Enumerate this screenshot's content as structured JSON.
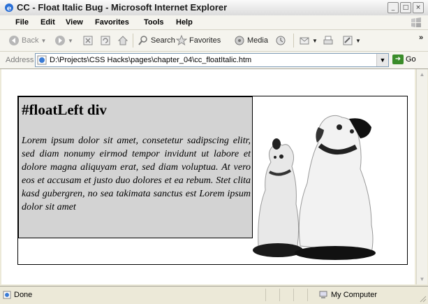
{
  "window": {
    "title": "CC - Float Italic Bug - Microsoft Internet Explorer"
  },
  "menu": {
    "items": [
      "File",
      "Edit",
      "View",
      "Favorites",
      "Tools",
      "Help"
    ]
  },
  "toolbar": {
    "back": "Back",
    "search": "Search",
    "favorites": "Favorites",
    "media": "Media",
    "chevron": "»"
  },
  "address": {
    "label": "Address",
    "url": "D:\\Projects\\CSS Hacks\\pages\\chapter_04\\cc_floatItalic.htm",
    "go": "Go"
  },
  "page": {
    "heading": "#floatLeft div",
    "body": "Lorem ipsum dolor sit amet, consetetur sadipscing elitr, sed diam nonumy eirmod tempor invidunt ut labore et dolore magna aliquyam erat, sed diam voluptua. At vero eos et accusam et justo duo dolores et ea rebum. Stet clita kasd gubergren, no sea takimata sanctus est Lorem ipsum dolor sit amet",
    "colors": {
      "float_bg": "#d3d3d3",
      "border": "#000000"
    }
  },
  "status": {
    "text": "Done",
    "zone": "My Computer"
  },
  "icons": {
    "titlebar": "ie-icon",
    "back": "back-arrow-icon",
    "forward": "forward-arrow-icon",
    "stop": "stop-icon",
    "refresh": "refresh-icon",
    "home": "home-icon",
    "search": "search-icon",
    "favorites": "star-icon",
    "media": "media-icon",
    "history": "history-icon",
    "mail": "mail-icon",
    "print": "print-icon",
    "edit": "edit-icon",
    "page": "page-icon",
    "go": "go-arrow-icon",
    "computer": "computer-icon",
    "status": "page-done-icon"
  }
}
